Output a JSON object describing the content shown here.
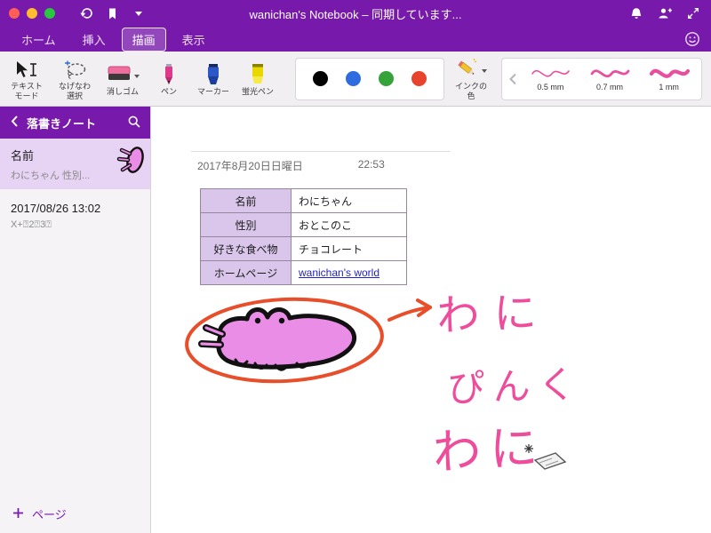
{
  "titlebar": {
    "title": "wanichan's Notebook – 同期しています..."
  },
  "tabs": [
    {
      "label": "ホーム"
    },
    {
      "label": "挿入"
    },
    {
      "label": "描画"
    },
    {
      "label": "表示"
    }
  ],
  "ribbon": {
    "tools": {
      "text_mode": "テキストモード",
      "lasso": "なげなわ選択",
      "eraser": "消しゴム",
      "pen": "ペン",
      "marker": "マーカー",
      "highlighter": "蛍光ペン",
      "ink_color": "インクの色"
    },
    "palette": [
      "#000000",
      "#2e6ce0",
      "#35a33a",
      "#e8432d"
    ],
    "thickness": [
      {
        "label": "0.5 mm"
      },
      {
        "label": "0.7 mm"
      },
      {
        "label": "1 mm"
      }
    ]
  },
  "sidebar": {
    "notebook_title": "落書きノート",
    "pages": [
      {
        "title": "名前",
        "preview": "わにちゃん 性別..."
      },
      {
        "title": "2017/08/26 13:02",
        "preview": "X+⍰2⍰3⍰"
      }
    ],
    "add_page_label": "ページ"
  },
  "page": {
    "date": "2017年8月20日日曜日",
    "time": "22:53",
    "table": [
      {
        "label": "名前",
        "value": "わにちゃん"
      },
      {
        "label": "性別",
        "value": "おとこのこ"
      },
      {
        "label": "好きな食べ物",
        "value": "チョコレート"
      },
      {
        "label": "ホームページ",
        "value": "wanichan's world"
      }
    ],
    "handwriting": {
      "word1": "わに",
      "word2": "ぴんく",
      "word3": "わに"
    }
  },
  "colors": {
    "accent": "#7719aa",
    "ink_pink": "#ee4d9c",
    "doodle_fill": "#ea8de6",
    "annotation_red": "#e84e2a",
    "link_blue": "#2323c8"
  }
}
